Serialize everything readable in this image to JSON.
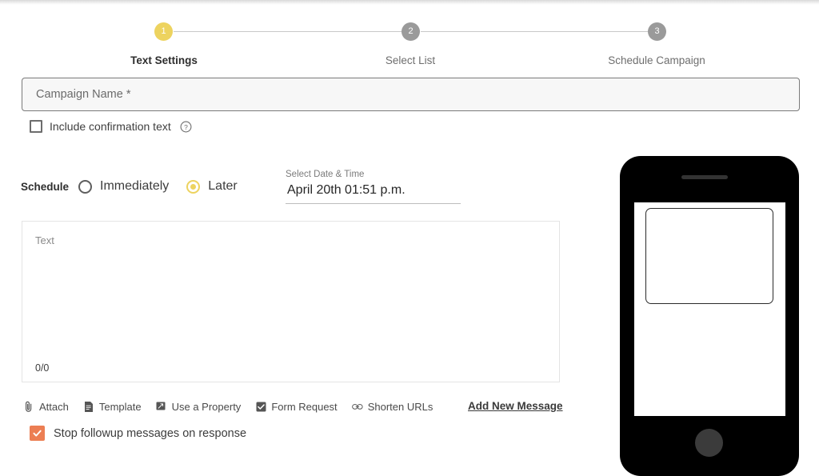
{
  "stepper": {
    "steps": [
      {
        "number": "1",
        "label": "Text Settings",
        "state": "active"
      },
      {
        "number": "2",
        "label": "Select List",
        "state": "inactive"
      },
      {
        "number": "3",
        "label": "Schedule Campaign",
        "state": "inactive"
      }
    ]
  },
  "form": {
    "campaign_name": {
      "value": "",
      "placeholder": "Campaign Name *"
    },
    "include_confirmation": {
      "label": "Include confirmation text",
      "checked": false,
      "help_icon": "question-circle-icon"
    },
    "schedule": {
      "caption": "Schedule",
      "options": [
        {
          "label": "Immediately",
          "selected": false
        },
        {
          "label": "Later",
          "selected": true
        }
      ]
    },
    "datetime": {
      "label": "Select Date & Time",
      "value": "April 20th 01:51 p.m."
    },
    "message": {
      "placeholder": "Text",
      "value": "",
      "counter": "0/0"
    },
    "toolbar": {
      "items": [
        {
          "label": "Attach",
          "icon": "paperclip-icon"
        },
        {
          "label": "Template",
          "icon": "document-icon"
        },
        {
          "label": "Use a Property",
          "icon": "property-tag-icon"
        },
        {
          "label": "Form Request",
          "icon": "checkbox-filled-icon"
        },
        {
          "label": "Shorten URLs",
          "icon": "link-chain-icon"
        }
      ],
      "add_new_message": "Add New Message"
    },
    "stop_followup": {
      "label": "Stop followup messages on response",
      "checked": true
    }
  },
  "preview": {
    "device": "smartphone-mockup",
    "bubble": "empty-message-bubble"
  },
  "colors": {
    "accent_yellow": "#edd35f",
    "inactive_gray": "#9a9a9a",
    "checkbox_orange": "#ec7e53",
    "text_dark": "#3c3c3c",
    "border_light": "#e4e4e4"
  }
}
